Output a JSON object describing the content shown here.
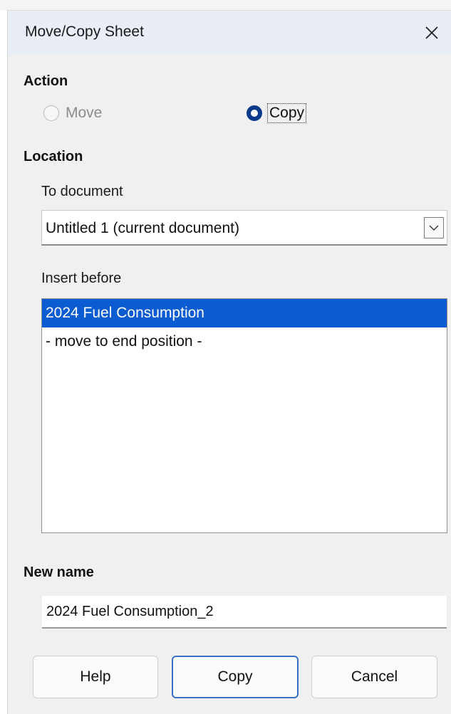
{
  "dialog": {
    "title": "Move/Copy Sheet"
  },
  "action": {
    "heading": "Action",
    "options": [
      {
        "label": "Move",
        "checked": false,
        "disabled": true
      },
      {
        "label": "Copy",
        "checked": true,
        "disabled": false
      }
    ]
  },
  "location": {
    "heading": "Location",
    "to_document_label": "To document",
    "to_document_value": "Untitled 1 (current document)",
    "insert_before_label": "Insert before",
    "insert_before_items": [
      {
        "label": "2024 Fuel Consumption",
        "selected": true
      },
      {
        "label": "- move to end position -",
        "selected": false
      }
    ]
  },
  "new_name": {
    "heading": "New name",
    "value": "2024 Fuel Consumption_2"
  },
  "buttons": {
    "help": "Help",
    "copy": "Copy",
    "cancel": "Cancel"
  },
  "colors": {
    "selection": "#0b5bd1",
    "radio_checked": "#0a3a8c",
    "titlebar": "#e9edf5"
  }
}
